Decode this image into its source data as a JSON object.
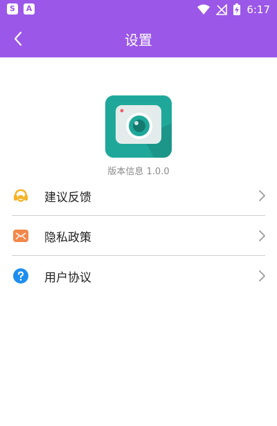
{
  "status_bar": {
    "badges": [
      "S",
      "A"
    ],
    "time": "6:17",
    "icons": [
      "wifi-icon",
      "no-signal-icon",
      "battery-charging-icon"
    ]
  },
  "header": {
    "title": "设置",
    "back_icon": "chevron-left-icon",
    "background_color": "#9b57e8"
  },
  "app_info": {
    "logo_icon": "camera-app-logo",
    "version_text": "版本信息 1.0.0"
  },
  "menu": {
    "items": [
      {
        "label": "建议反馈",
        "icon": "headset-icon",
        "icon_color": "#f5b325"
      },
      {
        "label": "隐私政策",
        "icon": "mail-icon",
        "icon_color": "#f2874a"
      },
      {
        "label": "用户协议",
        "icon": "help-icon",
        "icon_color": "#1e8df0"
      }
    ],
    "chevron_icon": "chevron-right-icon"
  }
}
